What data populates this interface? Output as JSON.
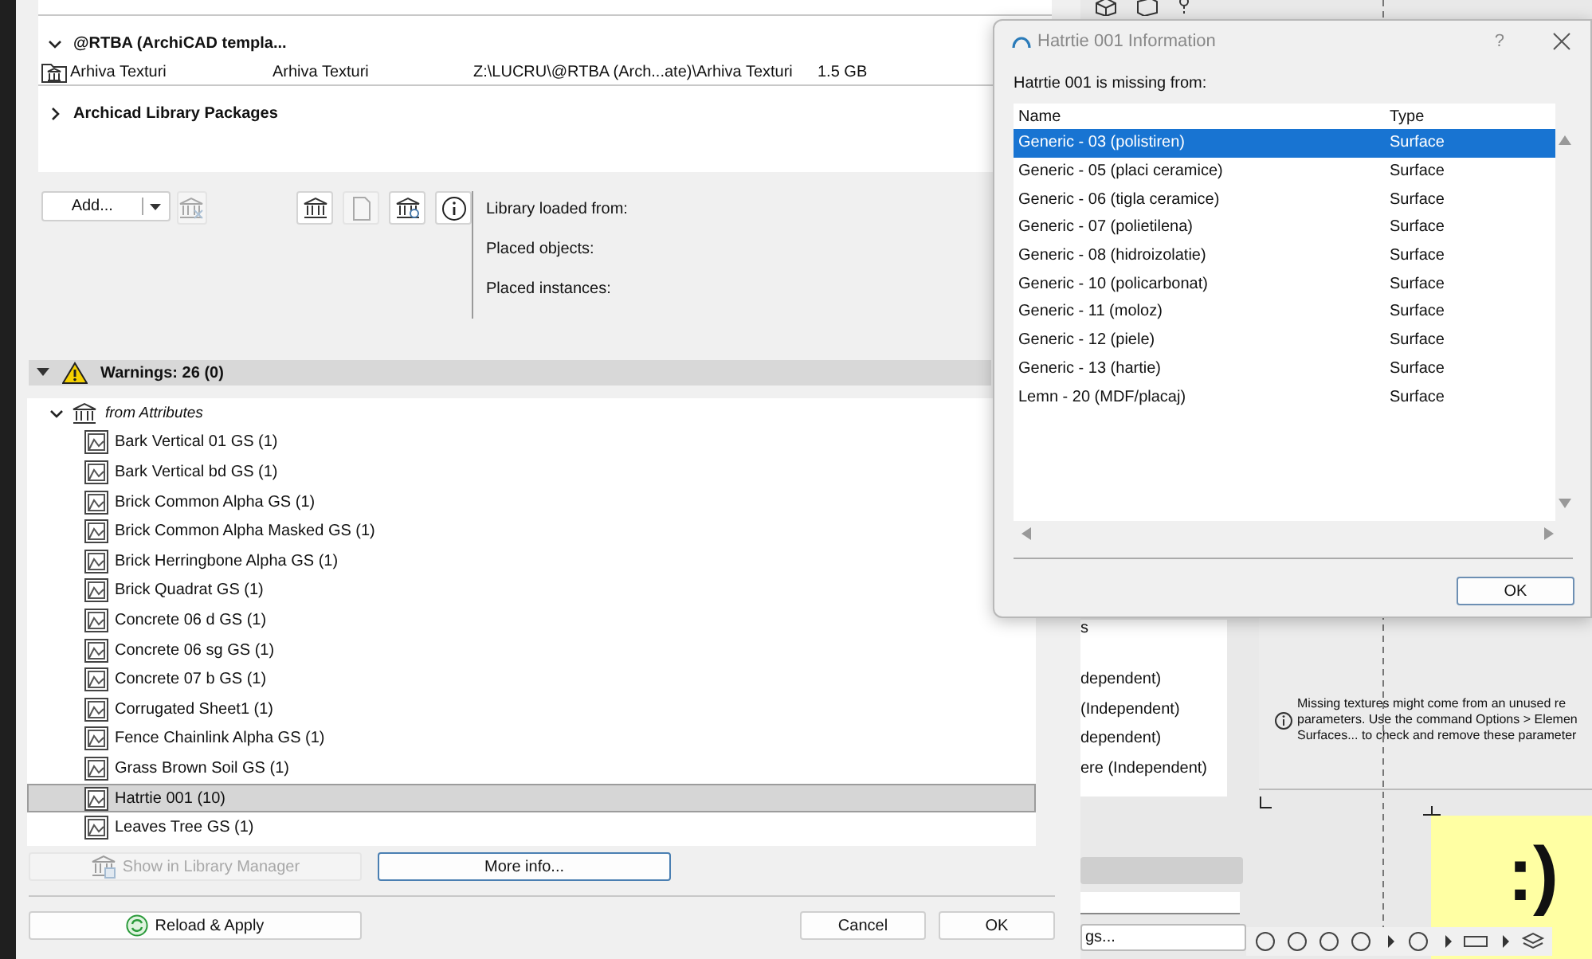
{
  "library_dialog": {
    "sections": [
      {
        "title": "@RTBA (ArchiCAD templa...",
        "expanded": true,
        "libraries": [
          {
            "name": "Arhiva Texturi",
            "column_2": "Arhiva Texturi",
            "path": "Z:\\LUCRU\\@RTBA (Arch...ate)\\Arhiva Texturi",
            "size": "1.5 GB"
          }
        ]
      },
      {
        "title": "Archicad Library Packages",
        "expanded": false
      }
    ],
    "add_button": "Add...",
    "info_labels": [
      "Library loaded from:",
      "Placed objects:",
      "Placed instances:"
    ],
    "warnings": {
      "title": "Warnings: 26 (0)",
      "expanded": true,
      "groups": [
        {
          "label": "from Attributes",
          "expanded": true,
          "children": [
            {
              "label": "Bark Vertical 01 GS (1)",
              "selected": false
            },
            {
              "label": "Bark Vertical bd GS (1)",
              "selected": false
            },
            {
              "label": "Brick Common Alpha GS (1)",
              "selected": false
            },
            {
              "label": "Brick Common Alpha Masked GS (1)",
              "selected": false
            },
            {
              "label": "Brick Herringbone Alpha GS (1)",
              "selected": false
            },
            {
              "label": "Brick Quadrat GS (1)",
              "selected": false
            },
            {
              "label": "Concrete 06 d GS (1)",
              "selected": false
            },
            {
              "label": "Concrete 06 sg GS (1)",
              "selected": false
            },
            {
              "label": "Concrete 07 b GS (1)",
              "selected": false
            },
            {
              "label": "Corrugated Sheet1 (1)",
              "selected": false
            },
            {
              "label": "Fence Chainlink Alpha GS (1)",
              "selected": false
            },
            {
              "label": "Grass Brown Soil GS (1)",
              "selected": false
            },
            {
              "label": "Hatrtie 001 (10)",
              "selected": true
            },
            {
              "label": "Leaves Tree GS (1)",
              "selected": false
            }
          ]
        }
      ]
    },
    "show_button": {
      "label": "Show in Library Manager",
      "disabled": true
    },
    "more_button": "More info...",
    "reload_button": "Reload & Apply",
    "cancel_button": "Cancel",
    "ok_button": "OK"
  },
  "background": {
    "list_fragments": [
      "s",
      "dependent)",
      "(Independent)",
      "dependent)",
      "ere (Independent)"
    ],
    "note": "Missing textures might come from an unused re parameters. Use the command Options > Elemen Surfaces... to check and remove these parameter",
    "field_fragment": "gs...",
    "canvas_text": ":)"
  },
  "info_dialog": {
    "title": "Hatrtie 001 Information",
    "help": "?",
    "message": "Hatrtie 001 is missing from:",
    "columns": [
      "Name",
      "Type"
    ],
    "rows": [
      {
        "name": "Generic - 03 (polistiren)",
        "type": "Surface",
        "selected": true
      },
      {
        "name": "Generic - 05 (placi ceramice)",
        "type": "Surface",
        "selected": false
      },
      {
        "name": "Generic - 06 (tigla ceramice)",
        "type": "Surface",
        "selected": false
      },
      {
        "name": "Generic - 07 (polietilena)",
        "type": "Surface",
        "selected": false
      },
      {
        "name": "Generic - 08 (hidroizolatie)",
        "type": "Surface",
        "selected": false
      },
      {
        "name": "Generic - 10 (policarbonat)",
        "type": "Surface",
        "selected": false
      },
      {
        "name": "Generic - 11 (moloz)",
        "type": "Surface",
        "selected": false
      },
      {
        "name": "Generic - 12 (piele)",
        "type": "Surface",
        "selected": false
      },
      {
        "name": "Generic - 13 (hartie)",
        "type": "Surface",
        "selected": false
      },
      {
        "name": "Lemn - 20 (MDF/placaj)",
        "type": "Surface",
        "selected": false
      }
    ],
    "ok_button": "OK"
  }
}
